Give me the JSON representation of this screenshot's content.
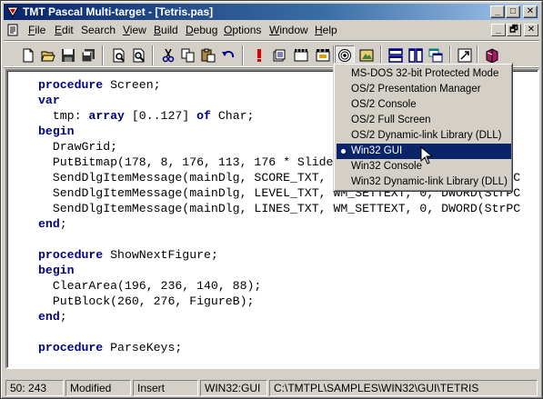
{
  "window": {
    "title": "TMT Pascal Multi-target - [Tetris.pas]",
    "min_glyph": "_",
    "max_glyph": "□",
    "close_glyph": "✕"
  },
  "menu": {
    "items": [
      {
        "underline": "F",
        "rest": "ile"
      },
      {
        "underline": "E",
        "rest": "dit"
      },
      {
        "underline": "",
        "rest": "Search"
      },
      {
        "underline": "V",
        "rest": "iew"
      },
      {
        "underline": "B",
        "rest": "uild"
      },
      {
        "underline": "D",
        "rest": "ebug"
      },
      {
        "underline": "O",
        "rest": "ptions"
      },
      {
        "underline": "W",
        "rest": "indow"
      },
      {
        "underline": "H",
        "rest": "elp"
      }
    ],
    "mdi_min": "_",
    "mdi_restore": "🗗",
    "mdi_close": "✕"
  },
  "toolbar": {
    "buttons": [
      "new-file-icon",
      "open-folder-icon",
      "save-icon",
      "save-all-icon",
      "print-preview-icon",
      "find-icon",
      "cut-icon",
      "copy-icon",
      "paste-icon",
      "undo-icon",
      "run-icon",
      "compile-icon",
      "build-icon",
      "make-icon",
      "target-icon",
      "target-options-icon",
      "tile-horizontal-icon",
      "tile-vertical-icon",
      "cascade-icon",
      "info-icon",
      "help-book-icon"
    ]
  },
  "editor": {
    "lines": [
      [
        {
          "t": "procedure",
          "k": true
        },
        {
          "t": " Screen;"
        }
      ],
      [
        {
          "t": "var",
          "k": true
        }
      ],
      [
        {
          "t": "  tmp: "
        },
        {
          "t": "array",
          "k": true
        },
        {
          "t": " [0..127] "
        },
        {
          "t": "of",
          "k": true
        },
        {
          "t": " Char;"
        }
      ],
      [
        {
          "t": "begin",
          "k": true
        }
      ],
      [
        {
          "t": "  DrawGrid;"
        }
      ],
      [
        {
          "t": "  PutBitmap(178, 8, 176, 113, 176 * Slide"
        }
      ],
      [
        {
          "t": "  SendDlgItemMessage(mainDlg, SCORE_TXT, WM_SETTEXT, 0, DWORD(StrPC"
        }
      ],
      [
        {
          "t": "  SendDlgItemMessage(mainDlg, LEVEL_TXT, WM_SETTEXT, 0, DWORD(StrPC"
        }
      ],
      [
        {
          "t": "  SendDlgItemMessage(mainDlg, LINES_TXT, WM_SETTEXT, 0, DWORD(StrPC"
        }
      ],
      [
        {
          "t": "end",
          "k": true
        },
        {
          "t": ";"
        }
      ],
      [
        {
          "t": ""
        }
      ],
      [
        {
          "t": "procedure",
          "k": true
        },
        {
          "t": " ShowNextFigure;"
        }
      ],
      [
        {
          "t": "begin",
          "k": true
        }
      ],
      [
        {
          "t": "  ClearArea(196, 236, 140, 88);"
        }
      ],
      [
        {
          "t": "  PutBlock(260, 276, FigureB);"
        }
      ],
      [
        {
          "t": "end",
          "k": true
        },
        {
          "t": ";"
        }
      ],
      [
        {
          "t": ""
        }
      ],
      [
        {
          "t": "procedure",
          "k": true
        },
        {
          "t": " ParseKeys;"
        }
      ]
    ]
  },
  "target_menu": {
    "items": [
      {
        "label": "MS-DOS 32-bit Protected Mode",
        "selected": false
      },
      {
        "label": "OS/2 Presentation Manager",
        "selected": false
      },
      {
        "label": "OS/2 Console",
        "selected": false
      },
      {
        "label": "OS/2 Full Screen",
        "selected": false
      },
      {
        "label": "OS/2 Dynamic-link Library (DLL)",
        "selected": false
      },
      {
        "label": "Win32 GUI",
        "selected": true
      },
      {
        "label": "Win32 Console",
        "selected": false
      },
      {
        "label": "Win32 Dynamic-link Library (DLL)",
        "selected": false
      }
    ]
  },
  "status": {
    "position": "50: 243",
    "modified": "Modified",
    "mode": "Insert",
    "target": "WIN32:GUI",
    "path": "C:\\TMTPL\\SAMPLES\\WIN32\\GUI\\TETRIS"
  },
  "colors": {
    "keyword": "#000080",
    "selection": "#0a246a",
    "face": "#d4d0c8"
  }
}
